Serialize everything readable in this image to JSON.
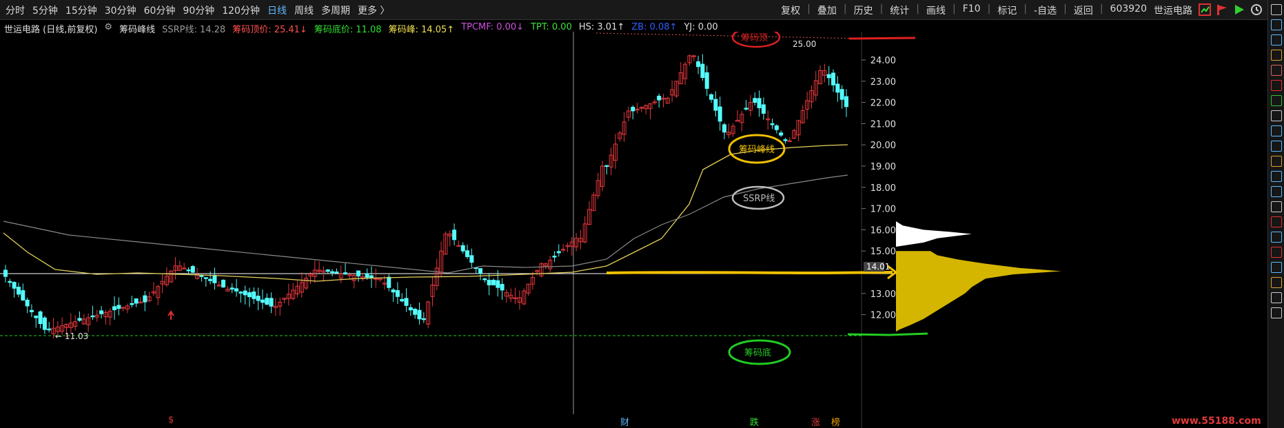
{
  "toolbar": {
    "periods": [
      "分时",
      "5分钟",
      "15分钟",
      "30分钟",
      "60分钟",
      "90分钟",
      "120分钟",
      "日线",
      "周线",
      "多周期",
      "更多 〉"
    ],
    "active_period": "日线",
    "actions": [
      "复权",
      "叠加",
      "历史",
      "统计",
      "画线",
      "F10",
      "标记",
      "-自选",
      "返回"
    ],
    "stock_code": "603920",
    "stock_name": "世运电路"
  },
  "info": {
    "title": "世运电路 (日线,前复权)",
    "indicator_name": "筹码峰线",
    "ssrp": "SSRP线: 14.28",
    "top_price": "筹码顶价: 25.41↓",
    "bottom_price": "筹码底价: 11.08",
    "peak": "筹码峰: 14.05↑",
    "tpcmf": "TPCMF: 0.00↓",
    "tpt": "TPT: 0.00",
    "hs": "HS: 3.01↑",
    "zb": "ZB: 0.08↑",
    "yj": "YJ: 0.00"
  },
  "colors": {
    "up": "#e8383d",
    "down": "#54fcfc",
    "yellow_line": "#e6d25a",
    "gray_line": "#8a8a8a",
    "peak_fill": "#d4b600",
    "profile_fill": "#ffffff",
    "annot_red": "#e02020",
    "annot_yellow": "#f0c000",
    "annot_green": "#22cc22"
  },
  "axis": {
    "ticks": [
      "24.00",
      "23.00",
      "22.00",
      "21.00",
      "20.00",
      "19.00",
      "18.00",
      "17.00",
      "16.00",
      "15.00",
      "13.00",
      "12.00"
    ],
    "current_price_label": "14.01"
  },
  "annotations": {
    "top": "筹码顶",
    "peak": "筹码峰线",
    "ssrp": "SSRP线",
    "bottom": "筹码底",
    "high_label": "25.00",
    "low_label": "11.03"
  },
  "bottom_marks": [
    "$",
    "财",
    "跌",
    "涨",
    "榜"
  ],
  "watermark": "www.55188.com",
  "icons": [
    "chart-icon",
    "flag-icon",
    "play-icon",
    "clock-icon"
  ],
  "sidebar_icons": [
    "zoom-icon",
    "up-arrow-icon",
    "down-arrow-icon",
    "grid-icon",
    "table-icon",
    "line-icon",
    "kline-icon",
    "list-icon",
    "f10-icon",
    "doc-icon",
    "book-icon",
    "fiz-icon",
    "fx-icon",
    "star-icon",
    "wave-icon",
    "rsi-icon",
    "dollar-icon",
    "move-icon",
    "pen-icon",
    "f5-icon",
    "f6-icon"
  ]
}
